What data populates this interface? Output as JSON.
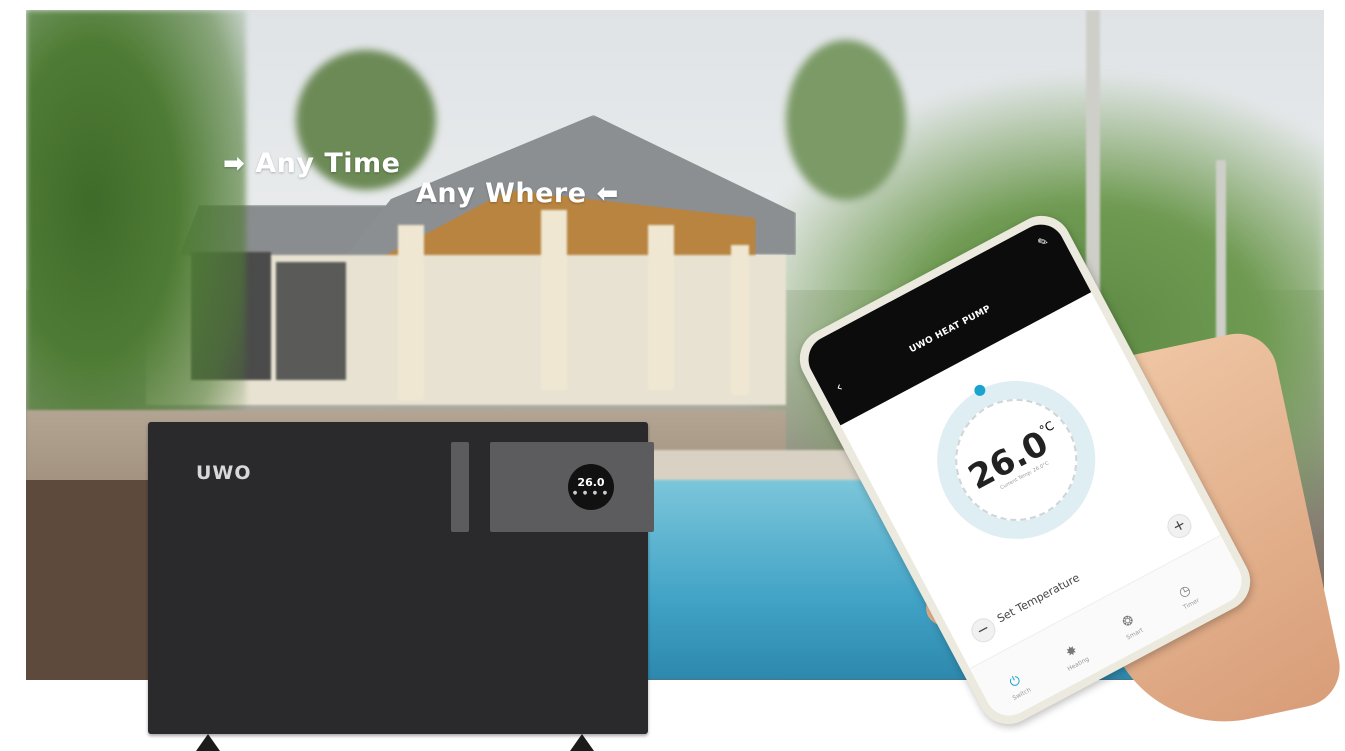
{
  "scene": {
    "tagline_1": "Any Time",
    "tagline_2": "Any Where"
  },
  "unit": {
    "logo": "UWO",
    "display_temp": "26.0",
    "display_buttons": "● ● ● ●"
  },
  "phone": {
    "app_title": "UWO HEAT PUMP",
    "current_temp": "26.0",
    "temp_unit": "°C",
    "current_temp_caption": "Current Temp: 26.0°C",
    "set_temperature_label": "Set Temperature",
    "minus_label": "−",
    "plus_label": "+",
    "nav": [
      {
        "label": "Switch",
        "icon": "power-icon"
      },
      {
        "label": "Heating",
        "icon": "sun-icon"
      },
      {
        "label": "Smart",
        "icon": "fan-icon"
      },
      {
        "label": "Timer",
        "icon": "clock-icon"
      }
    ]
  },
  "colors": {
    "accent": "#1aa3cf",
    "unit_body": "#2a2a2c",
    "pool": "#41a3c6"
  }
}
